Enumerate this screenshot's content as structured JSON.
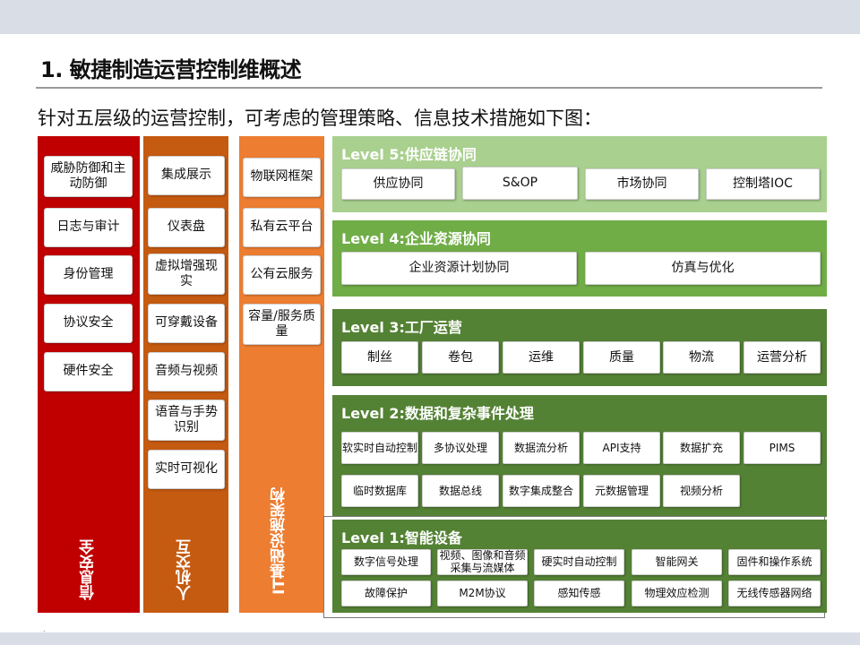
{
  "title": "1. 敏捷制造运营控制维概述",
  "subtitle": "针对五层级的运营控制，可考虑的管理策略、信息技术措施如下图：",
  "columns": {
    "security": {
      "label": "信息安全",
      "items": [
        "威胁防御和主动防御",
        "日志与审计",
        "身份管理",
        "协议安全",
        "硬件安全"
      ]
    },
    "hci": {
      "label": "人机交互",
      "items": [
        "集成展示",
        "仪表盘",
        "虚拟增强现实",
        "可穿戴设备",
        "音频与视频",
        "语音与手势识别",
        "实时可视化"
      ]
    },
    "infra": {
      "label": "IT基础设施架构",
      "items": [
        "物联网框架",
        "私有云平台",
        "公有云服务",
        "容量/服务质量"
      ]
    }
  },
  "levels": {
    "l5": {
      "title": "Level 5:供应链协同",
      "items": [
        "供应协同",
        "S&OP",
        "市场协同",
        "控制塔IOC"
      ]
    },
    "l4": {
      "title": "Level 4:企业资源协同",
      "items": [
        "企业资源计划协同",
        "仿真与优化"
      ]
    },
    "l3": {
      "title": "Level 3:工厂运营",
      "items": [
        "制丝",
        "卷包",
        "运维",
        "质量",
        "物流",
        "运营分析"
      ]
    },
    "l2": {
      "title": "Level 2:数据和复杂事件处理",
      "items": [
        "软实时自动控制",
        "多协议处理",
        "数据流分析",
        "API支持",
        "数据扩充",
        "PIMS",
        "临时数据库",
        "数据总线",
        "数字集成整合",
        "元数据管理",
        "视频分析"
      ]
    },
    "l1": {
      "title": "Level 1:智能设备",
      "items": [
        "数字信号处理",
        "视频、图像和音频采集与流媒体",
        "硬实时自动控制",
        "智能网关",
        "固件和操作系统",
        "故障保护",
        "M2M协议",
        "感知传感",
        "物理效应检测",
        "无线传感器网络"
      ]
    }
  },
  "colors": {
    "security": "#c00000",
    "hci": "#c55a11",
    "infra": "#ed7d31",
    "level5": "#a9d08e",
    "level4": "#70ad47",
    "level3": "#548235",
    "level2": "#548235",
    "level1": "#548235"
  }
}
